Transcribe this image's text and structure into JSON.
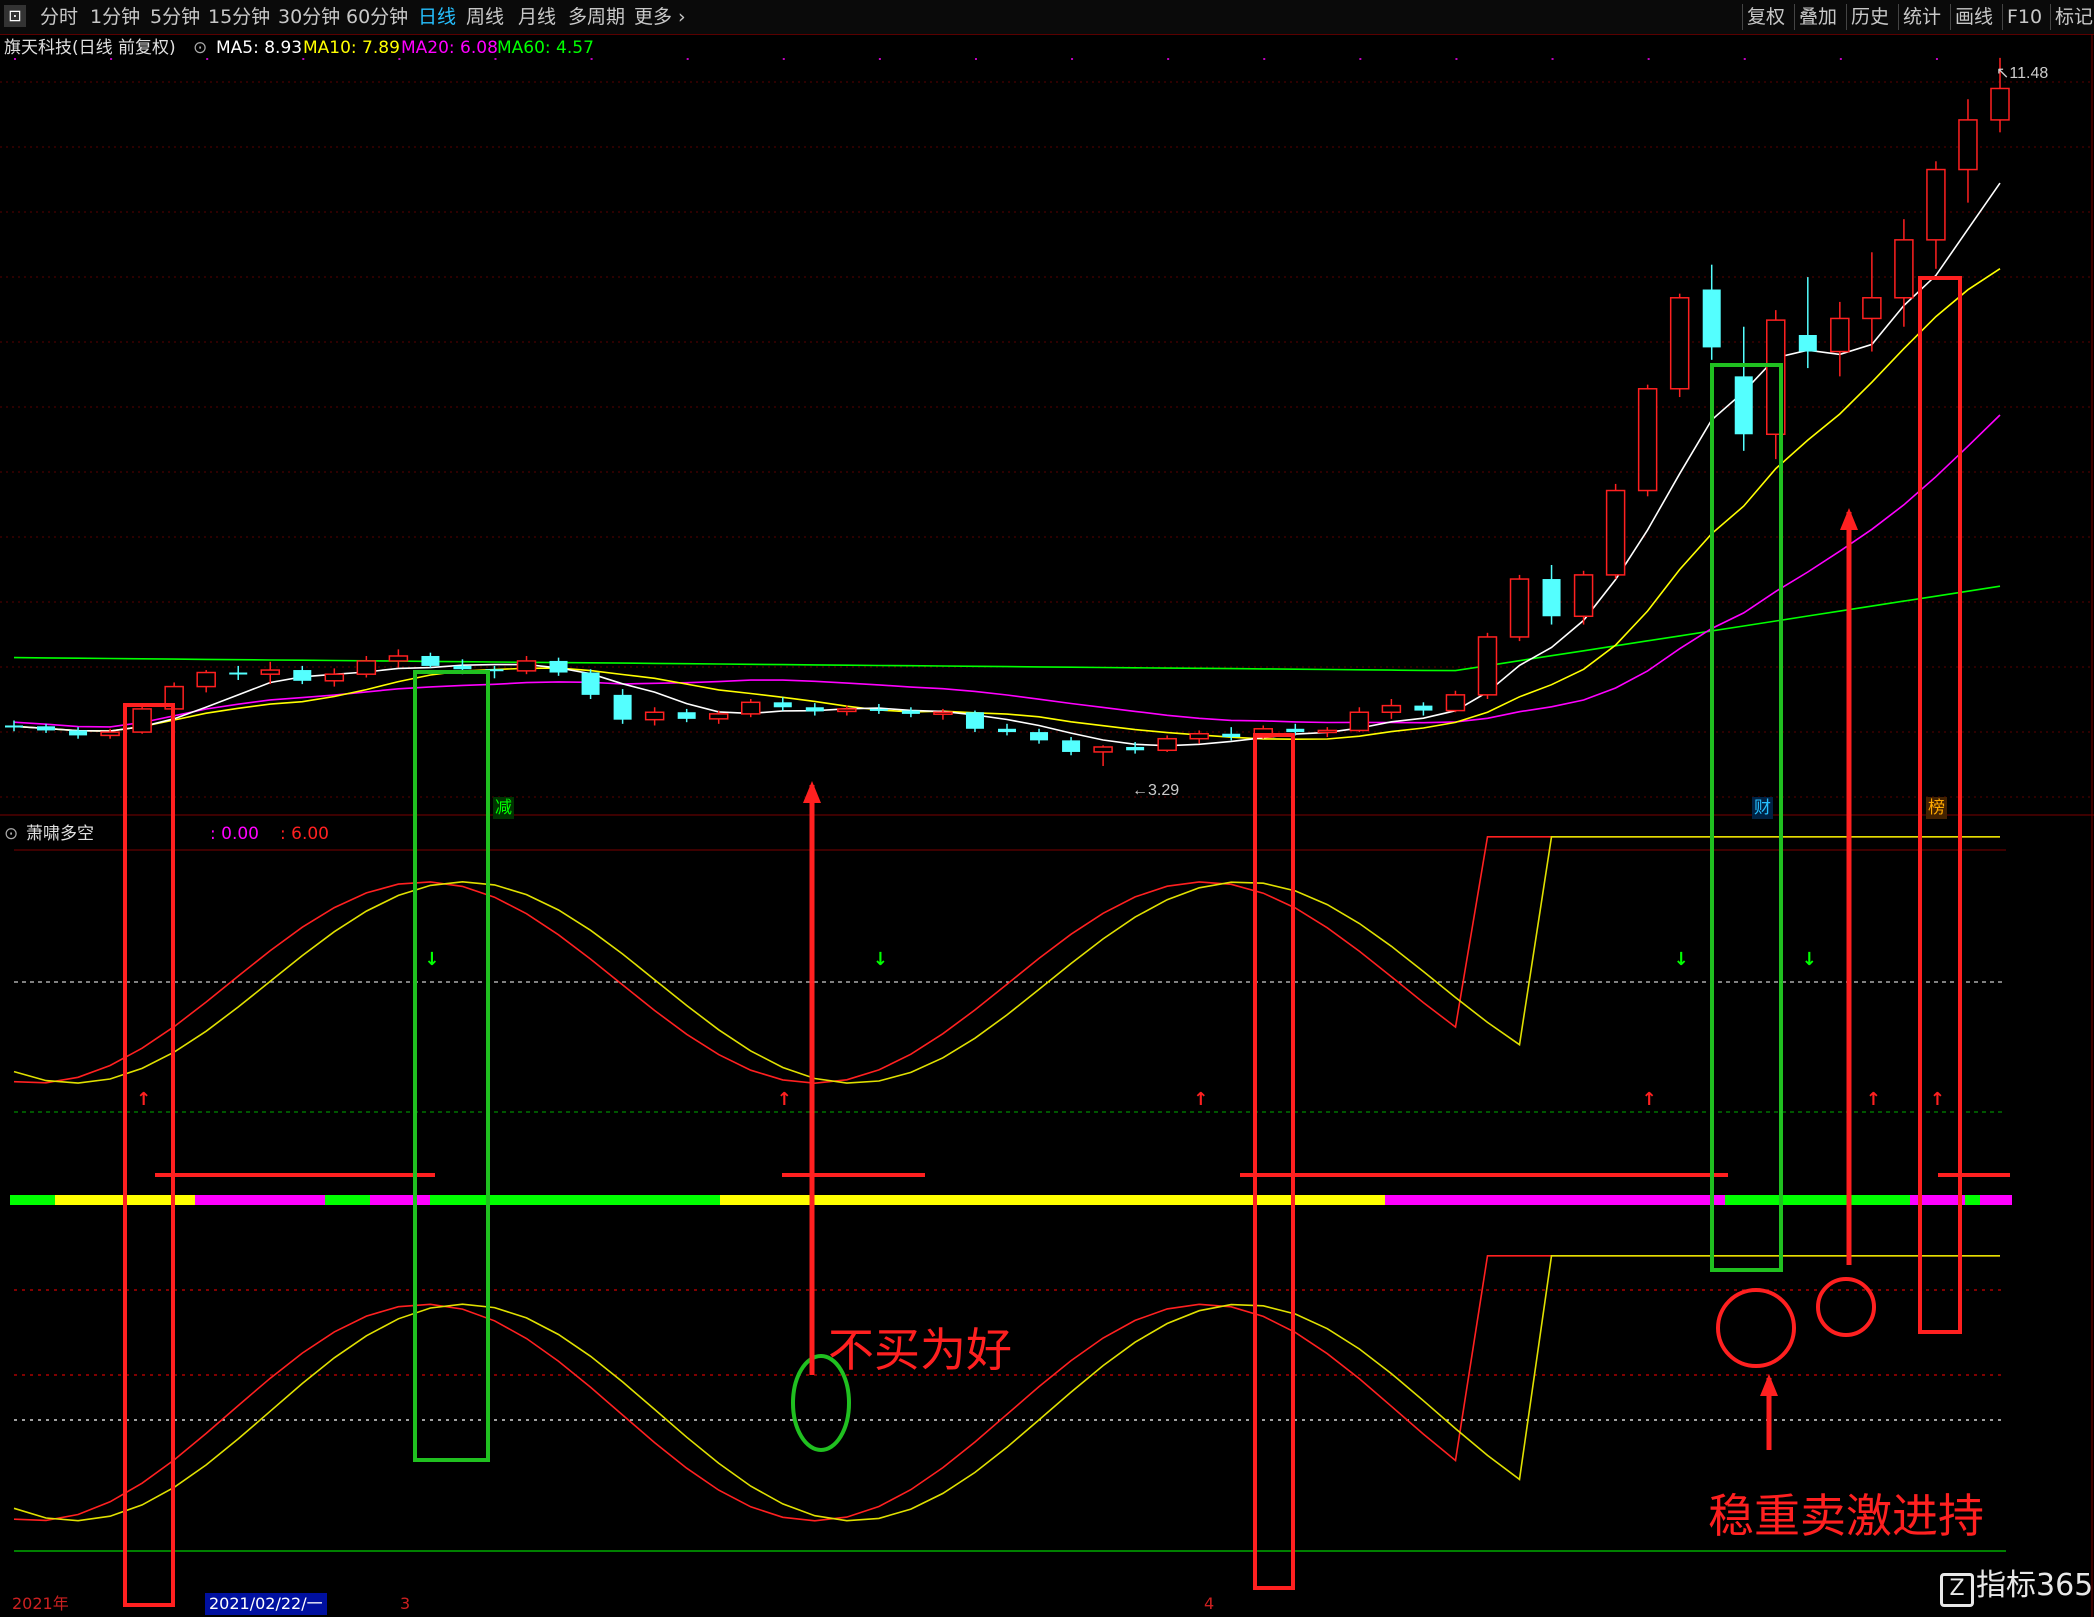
{
  "toolbar": {
    "corner_icon": "grid-icon",
    "tabs": [
      "分时",
      "1分钟",
      "5分钟",
      "15分钟",
      "30分钟",
      "60分钟",
      "日线",
      "周线",
      "月线",
      "多周期",
      "更多"
    ],
    "active_tab": "日线",
    "right_buttons": [
      "复权",
      "叠加",
      "历史",
      "统计",
      "画线",
      "F10",
      "标记"
    ]
  },
  "stock": {
    "title": "旗天科技(日线 前复权)",
    "ma": [
      {
        "label": "MA5: 8.93",
        "color": "#ffffff"
      },
      {
        "label": "MA10: 7.89",
        "color": "#ffff00"
      },
      {
        "label": "MA20: 6.08",
        "color": "#ff00ff"
      },
      {
        "label": "MA60: 4.57",
        "color": "#00ff00"
      }
    ]
  },
  "indicator": {
    "name": "萧啸多空",
    "v1": ": 0.00",
    "v2": ": 6.00",
    "v1_color": "#ff00ff",
    "v2_color": "#ff2020"
  },
  "badges": [
    {
      "text": "减",
      "color": "#00ff00",
      "bg": "#003300"
    },
    {
      "text": "财",
      "color": "#26c0ff",
      "bg": "#002244"
    },
    {
      "text": "榜",
      "color": "#ffaa00",
      "bg": "#442200"
    }
  ],
  "annotations": {
    "dont_buy": "不买为好",
    "hold": "稳重卖激进持"
  },
  "x_axis": [
    "2021年",
    "2021/02/22/一",
    "3",
    "4"
  ],
  "logo": "指标365",
  "colors": {
    "up": "#ff2020",
    "down": "#54ffff",
    "ma5": "#ffffff",
    "ma10": "#ffff00",
    "ma20": "#ff00ff",
    "ma60": "#00ff00"
  },
  "chart_data": {
    "type": "candlestick",
    "title": "旗天科技(日线 前复权)",
    "price_low_label": "3.29",
    "price_high_label": "11.48",
    "ohlc": [
      [
        3.78,
        3.84,
        3.71,
        3.77
      ],
      [
        3.77,
        3.8,
        3.69,
        3.72
      ],
      [
        3.72,
        3.76,
        3.62,
        3.66
      ],
      [
        3.66,
        3.74,
        3.62,
        3.7
      ],
      [
        3.7,
        4.05,
        3.68,
        3.98
      ],
      [
        3.98,
        4.3,
        3.95,
        4.25
      ],
      [
        4.25,
        4.45,
        4.18,
        4.42
      ],
      [
        4.42,
        4.5,
        4.33,
        4.4
      ],
      [
        4.4,
        4.55,
        4.28,
        4.45
      ],
      [
        4.45,
        4.5,
        4.28,
        4.32
      ],
      [
        4.32,
        4.47,
        4.25,
        4.4
      ],
      [
        4.4,
        4.62,
        4.36,
        4.56
      ],
      [
        4.56,
        4.7,
        4.48,
        4.62
      ],
      [
        4.62,
        4.66,
        4.48,
        4.5
      ],
      [
        4.5,
        4.58,
        4.4,
        4.46
      ],
      [
        4.46,
        4.5,
        4.35,
        4.44
      ],
      [
        4.44,
        4.62,
        4.4,
        4.56
      ],
      [
        4.56,
        4.6,
        4.38,
        4.42
      ],
      [
        4.42,
        4.46,
        4.1,
        4.15
      ],
      [
        4.15,
        4.22,
        3.8,
        3.85
      ],
      [
        3.85,
        4.0,
        3.78,
        3.94
      ],
      [
        3.94,
        3.98,
        3.82,
        3.86
      ],
      [
        3.86,
        3.96,
        3.8,
        3.92
      ],
      [
        3.92,
        4.1,
        3.88,
        4.06
      ],
      [
        4.06,
        4.12,
        3.96,
        4.0
      ],
      [
        4.0,
        4.05,
        3.9,
        3.95
      ],
      [
        3.95,
        4.02,
        3.9,
        3.98
      ],
      [
        3.98,
        4.04,
        3.92,
        3.96
      ],
      [
        3.96,
        4.0,
        3.88,
        3.92
      ],
      [
        3.92,
        3.98,
        3.85,
        3.94
      ],
      [
        3.94,
        3.96,
        3.7,
        3.74
      ],
      [
        3.74,
        3.8,
        3.66,
        3.7
      ],
      [
        3.7,
        3.74,
        3.56,
        3.6
      ],
      [
        3.6,
        3.64,
        3.42,
        3.46
      ],
      [
        3.46,
        3.54,
        3.29,
        3.52
      ],
      [
        3.52,
        3.58,
        3.44,
        3.48
      ],
      [
        3.48,
        3.66,
        3.46,
        3.62
      ],
      [
        3.62,
        3.72,
        3.56,
        3.68
      ],
      [
        3.68,
        3.76,
        3.6,
        3.64
      ],
      [
        3.64,
        3.78,
        3.62,
        3.74
      ],
      [
        3.74,
        3.8,
        3.66,
        3.7
      ],
      [
        3.7,
        3.76,
        3.64,
        3.72
      ],
      [
        3.72,
        4.0,
        3.7,
        3.94
      ],
      [
        3.94,
        4.1,
        3.86,
        4.02
      ],
      [
        4.02,
        4.06,
        3.9,
        3.96
      ],
      [
        3.96,
        4.2,
        3.94,
        4.15
      ],
      [
        4.15,
        4.9,
        4.1,
        4.85
      ],
      [
        4.85,
        5.6,
        4.8,
        5.55
      ],
      [
        5.55,
        5.72,
        5.0,
        5.1
      ],
      [
        5.1,
        5.65,
        5.0,
        5.6
      ],
      [
        5.6,
        6.7,
        5.55,
        6.62
      ],
      [
        6.62,
        7.9,
        6.55,
        7.85
      ],
      [
        7.85,
        9.0,
        7.75,
        8.95
      ],
      [
        9.05,
        9.35,
        8.2,
        8.35
      ],
      [
        8.0,
        8.6,
        7.1,
        7.3
      ],
      [
        7.3,
        8.8,
        7.0,
        8.68
      ],
      [
        8.5,
        9.2,
        8.1,
        8.3
      ],
      [
        8.3,
        8.9,
        8.0,
        8.7
      ],
      [
        8.7,
        9.5,
        8.3,
        8.95
      ],
      [
        8.95,
        9.9,
        8.6,
        9.65
      ],
      [
        9.65,
        10.6,
        9.3,
        10.5
      ],
      [
        10.5,
        11.35,
        10.1,
        11.1
      ],
      [
        11.1,
        11.85,
        10.95,
        11.48
      ]
    ],
    "ma_lines": [
      "MA5",
      "MA10",
      "MA20",
      "MA60"
    ],
    "indicator_name": "萧啸多空",
    "indicator_range": [
      0.0,
      6.0
    ],
    "buy_signals_index": [
      4,
      24,
      37,
      51,
      58,
      60
    ],
    "sell_signals_index": [
      13,
      27,
      52,
      56
    ],
    "legend": "top-left"
  }
}
